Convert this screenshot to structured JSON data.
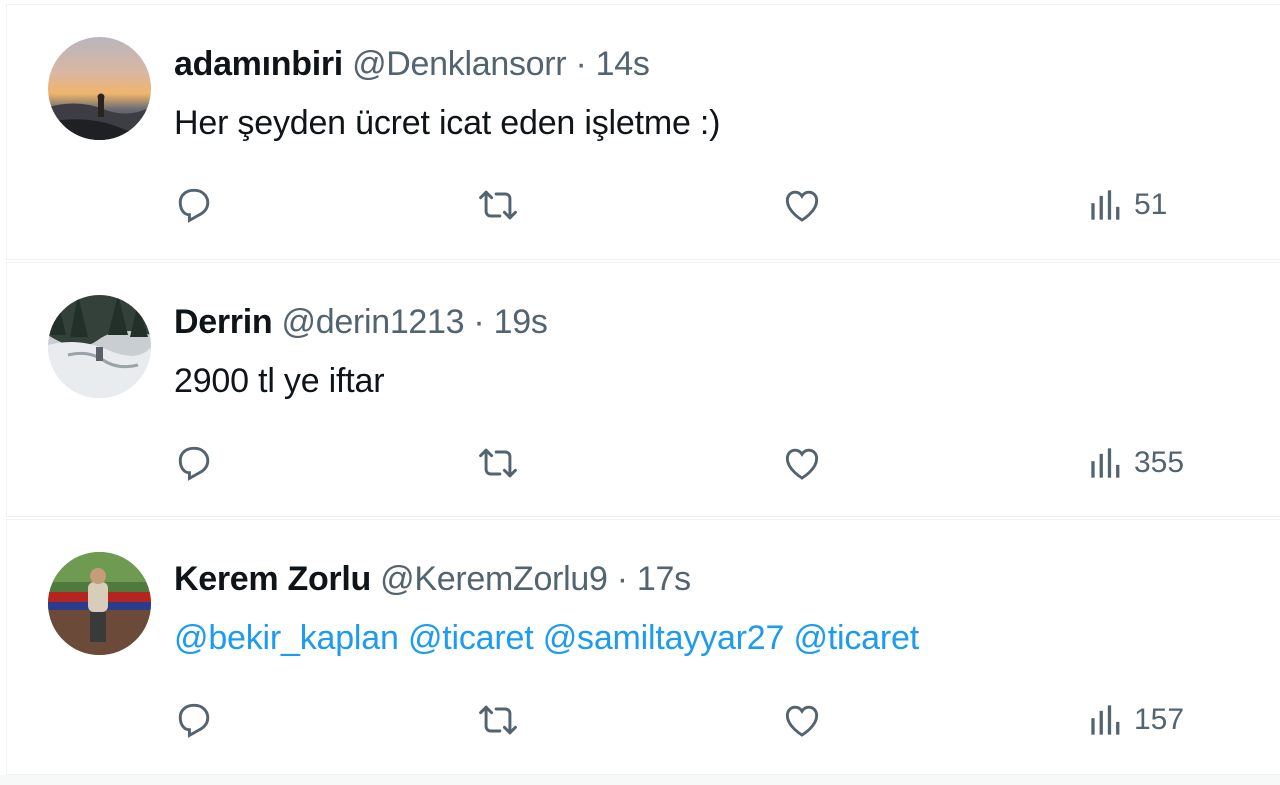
{
  "tweets": [
    {
      "name": "adamınbiri",
      "handle": "@Denklansorr",
      "separator": "·",
      "time": "14s",
      "text": "Her şeyden ücret icat eden işletme :)",
      "views": "51",
      "avatar": "sunset-silhouette"
    },
    {
      "name": "Derrin",
      "handle": "@derin1213",
      "separator": "·",
      "time": "19s",
      "text": "2900 tl ye iftar",
      "views": "355",
      "avatar": "snowy-forest"
    },
    {
      "name": "Kerem Zorlu",
      "handle": "@KeremZorlu9",
      "separator": "·",
      "time": "17s",
      "mentions": [
        "@bekir_kaplan",
        "@ticaret",
        "@samiltayyar27",
        "@ticaret"
      ],
      "views": "157",
      "avatar": "stadium-person"
    }
  ],
  "icons": {
    "reply": "reply-icon",
    "retweet": "retweet-icon",
    "like": "heart-icon",
    "views": "views-icon"
  },
  "colors": {
    "text": "#0f1419",
    "secondary": "#536471",
    "mention": "#1d9bf0",
    "border": "#eff3f4"
  }
}
